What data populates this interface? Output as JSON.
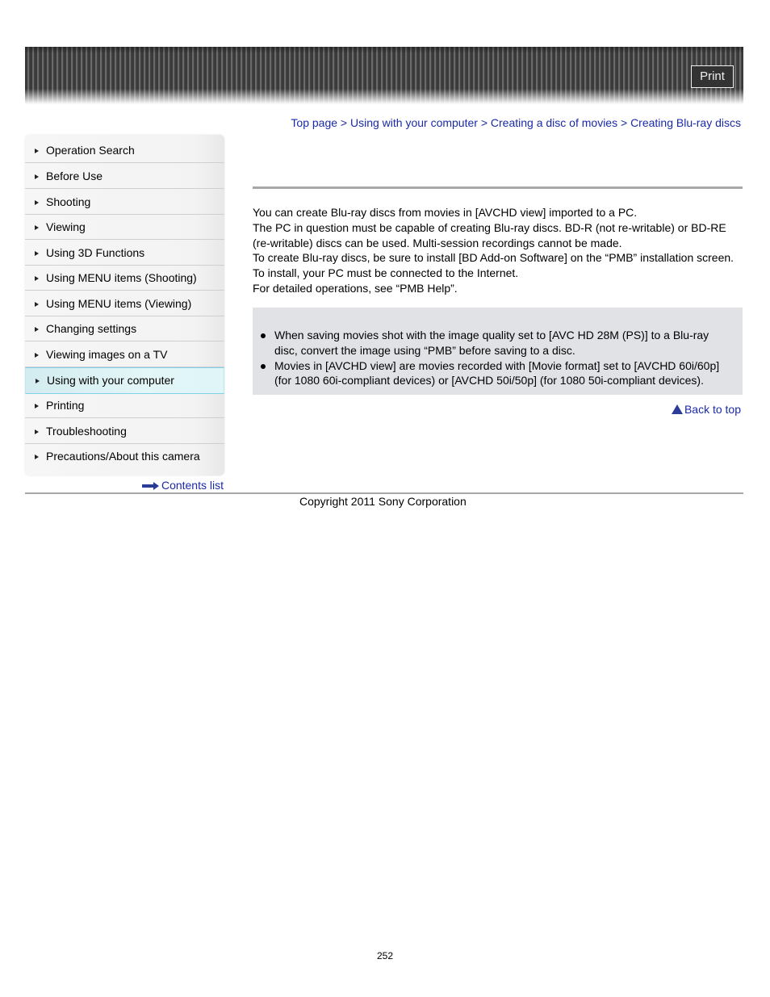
{
  "header": {
    "print_label": "Print"
  },
  "breadcrumb": {
    "items": [
      "Top page",
      "Using with your computer",
      "Creating a disc of movies",
      "Creating Blu-ray discs"
    ],
    "separator": ">"
  },
  "sidebar": {
    "items": [
      {
        "label": "Operation Search",
        "active": false
      },
      {
        "label": "Before Use",
        "active": false
      },
      {
        "label": "Shooting",
        "active": false
      },
      {
        "label": "Viewing",
        "active": false
      },
      {
        "label": "Using 3D Functions",
        "active": false
      },
      {
        "label": "Using MENU items (Shooting)",
        "active": false
      },
      {
        "label": "Using MENU items (Viewing)",
        "active": false
      },
      {
        "label": "Changing settings",
        "active": false
      },
      {
        "label": "Viewing images on a TV",
        "active": false
      },
      {
        "label": "Using with your computer",
        "active": true
      },
      {
        "label": "Printing",
        "active": false
      },
      {
        "label": "Troubleshooting",
        "active": false
      },
      {
        "label": "Precautions/About this camera",
        "active": false
      }
    ],
    "contents_list_label": "Contents list"
  },
  "main": {
    "intro_lines": [
      "You can create Blu-ray discs from movies in [AVCHD view] imported to a PC.",
      "The PC in question must be capable of creating Blu-ray discs. BD-R (not re-writable) or BD-RE (re-writable) discs can be used. Multi-session recordings cannot be made.",
      "To create Blu-ray discs, be sure to install [BD Add-on Software] on the “PMB” installation screen.",
      "To install, your PC must be connected to the Internet.",
      "For detailed operations, see “PMB Help”."
    ],
    "notes": [
      "When saving movies shot with the image quality set to [AVC HD 28M (PS)] to a Blu-ray disc, convert the image using “PMB” before saving to a disc.",
      "Movies in [AVCHD view] are movies recorded with [Movie format] set to [AVCHD 60i/60p] (for 1080 60i-compliant devices) or [AVCHD 50i/50p] (for 1080 50i-compliant devices)."
    ],
    "back_to_top_label": "Back to top"
  },
  "footer": {
    "copyright": "Copyright 2011 Sony Corporation",
    "page_number": "252"
  }
}
